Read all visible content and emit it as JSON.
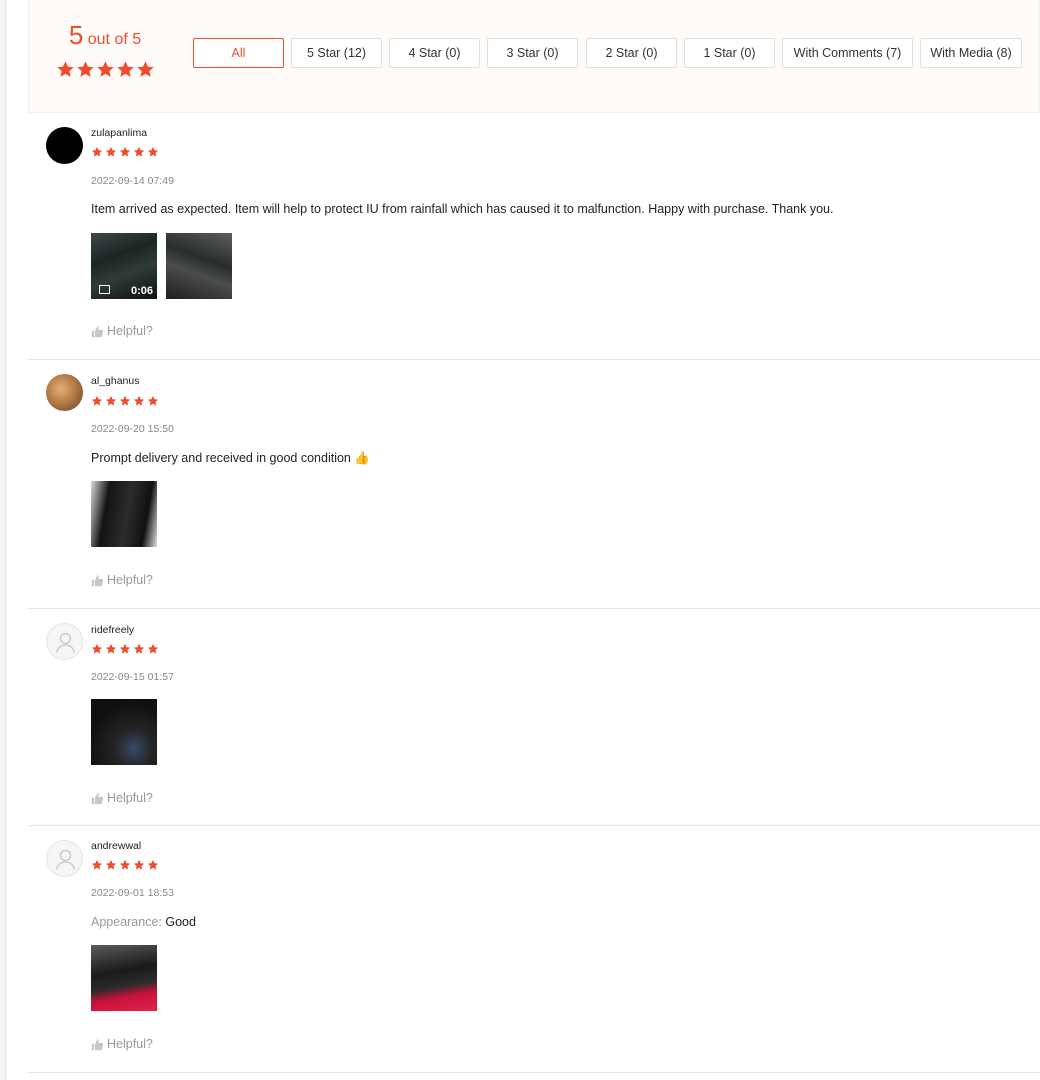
{
  "overview": {
    "rating": "5",
    "rating_suffix": " out of 5",
    "accent_color": "#ee4d2d",
    "filters": [
      {
        "label": "All",
        "active": true
      },
      {
        "label": "5 Star (12)",
        "active": false
      },
      {
        "label": "4 Star (0)",
        "active": false
      },
      {
        "label": "3 Star (0)",
        "active": false
      },
      {
        "label": "2 Star (0)",
        "active": false
      },
      {
        "label": "1 Star (0)",
        "active": false
      },
      {
        "label": "With Comments (7)",
        "active": false
      },
      {
        "label": "With Media (8)",
        "active": false
      }
    ]
  },
  "reviews": [
    {
      "username": "zulapanlima",
      "avatar": "black",
      "stars": 5,
      "date": "2022-09-14 07:49",
      "comment": "Item arrived as expected. Item will help to protect IU from rainfall which has caused it to malfunction. Happy with purchase. Thank you.",
      "media": [
        {
          "type": "video",
          "duration": "0:06",
          "icon": "video-camera-icon"
        },
        {
          "type": "image"
        }
      ],
      "helpful_label": "Helpful?"
    },
    {
      "username": "al_ghanus",
      "avatar": "photo",
      "stars": 5,
      "date": "2022-09-20 15:50",
      "comment": "Prompt delivery and received in good condition",
      "emoji": "👍",
      "media": [
        {
          "type": "image"
        }
      ],
      "helpful_label": "Helpful?"
    },
    {
      "username": "ridefreely",
      "avatar": "default-user-icon",
      "stars": 5,
      "date": "2022-09-15 01:57",
      "media": [
        {
          "type": "image"
        }
      ],
      "helpful_label": "Helpful?"
    },
    {
      "username": "andrewwal",
      "avatar": "default-user-icon",
      "stars": 5,
      "date": "2022-09-01 18:53",
      "attribute_label": "Appearance:",
      "attribute_value": "Good",
      "media": [
        {
          "type": "image"
        }
      ],
      "helpful_label": "Helpful?"
    }
  ]
}
